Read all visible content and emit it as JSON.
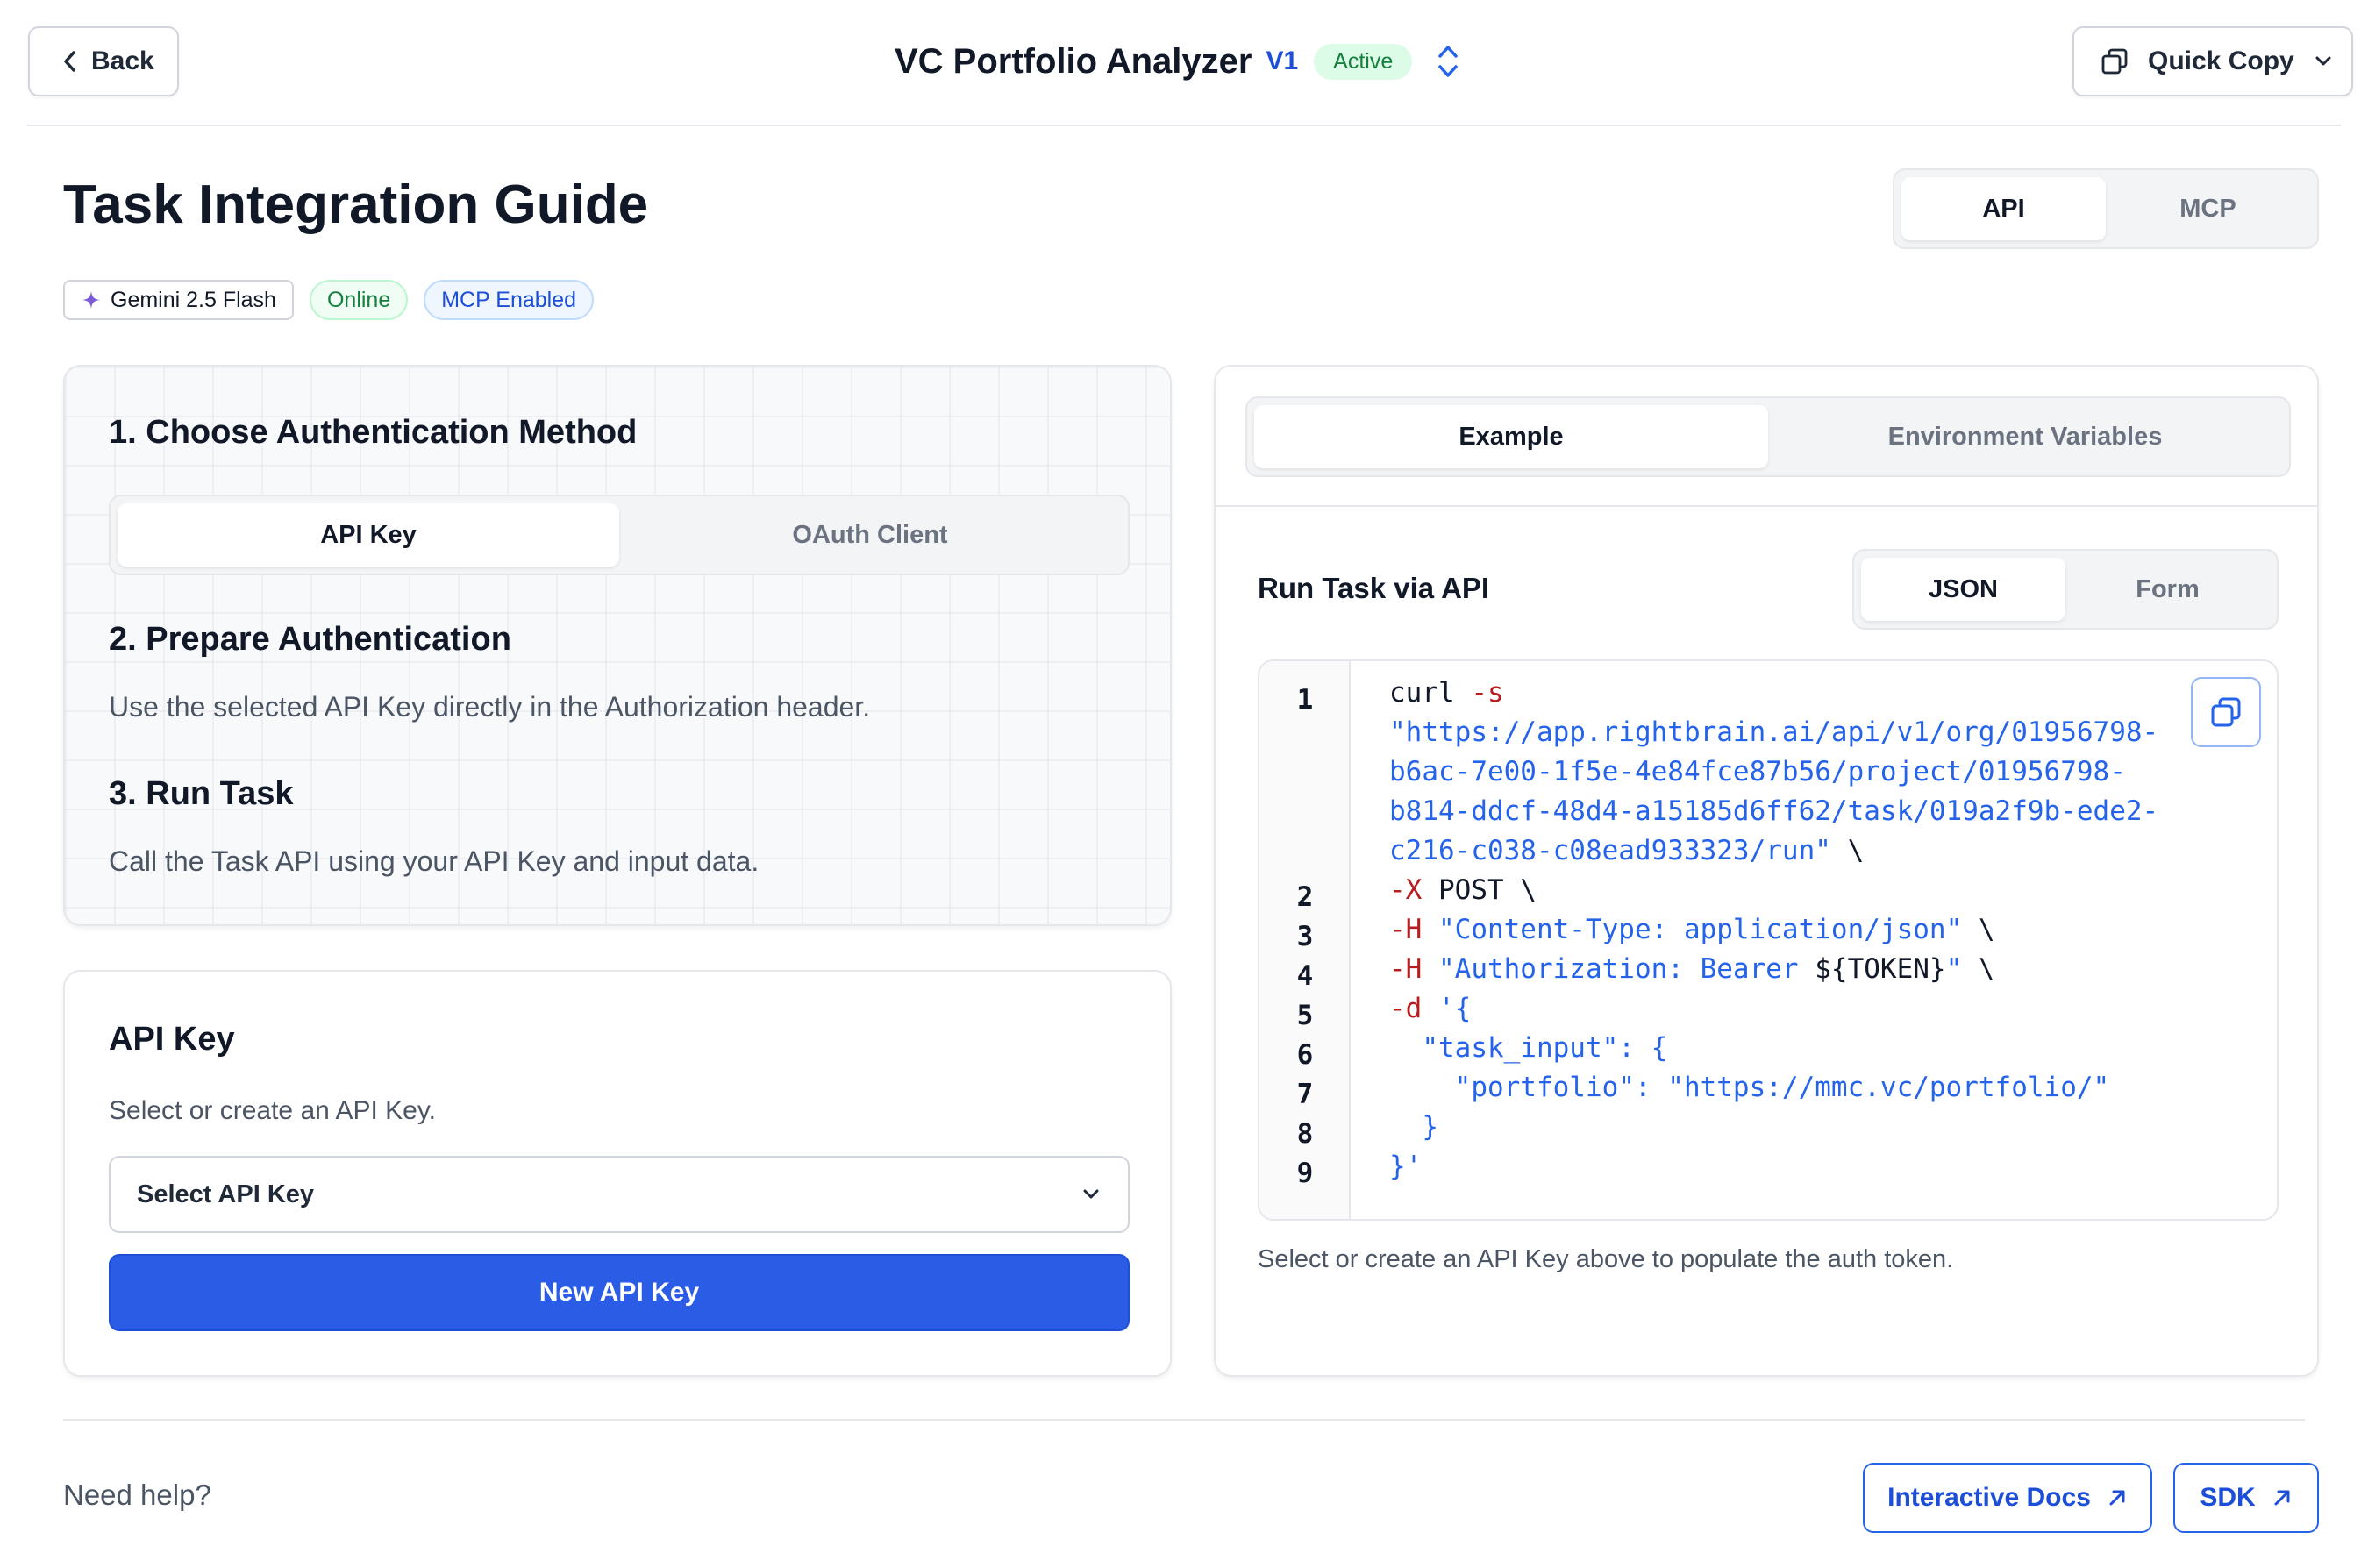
{
  "header": {
    "back_label": "Back",
    "app_title": "VC Portfolio Analyzer",
    "version": "V1",
    "status": "Active",
    "quick_copy_label": "Quick Copy"
  },
  "page": {
    "title": "Task Integration Guide",
    "badges": {
      "model": "Gemini 2.5 Flash",
      "online": "Online",
      "mcp": "MCP Enabled"
    },
    "mode_tabs": [
      {
        "label": "API",
        "active": true
      },
      {
        "label": "MCP",
        "active": false
      }
    ]
  },
  "guide": {
    "step1_title": "1. Choose Authentication Method",
    "auth_tabs": [
      {
        "label": "API Key",
        "active": true
      },
      {
        "label": "OAuth Client",
        "active": false
      }
    ],
    "step2_title": "2. Prepare Authentication",
    "step2_text": "Use the selected API Key directly in the Authorization header.",
    "step3_title": "3. Run Task",
    "step3_text": "Call the Task API using your API Key and input data."
  },
  "api_key": {
    "title": "API Key",
    "description": "Select or create an API Key.",
    "select_placeholder": "Select API Key",
    "new_button": "New API Key"
  },
  "example": {
    "tabs": [
      {
        "label": "Example",
        "active": true
      },
      {
        "label": "Environment Variables",
        "active": false
      }
    ],
    "section_title": "Run Task via API",
    "format_tabs": [
      {
        "label": "JSON",
        "active": true
      },
      {
        "label": "Form",
        "active": false
      }
    ],
    "line_numbers": [
      "1",
      "2",
      "3",
      "4",
      "5",
      "6",
      "7",
      "8",
      "9"
    ],
    "code": {
      "l1a_cmd": "curl ",
      "l1a_flag": "-s",
      "l1b": "\"https://app.rightbrain.ai/api/v1/org/01956798-",
      "l1c": "b6ac-7e00-1f5e-4e84fce87b56/project/01956798-",
      "l1d": "b814-ddcf-48d4-a15185d6ff62/task/019a2f9b-ede2-",
      "l1e_str": "c216-c038-c08ead933323/run\"",
      "l1e_tail": " \\",
      "l2_flag": "-X",
      "l2_rest": " POST \\",
      "l3_flag": "-H",
      "l3_str": " \"Content-Type: application/json\"",
      "l3_tail": " \\",
      "l4_flag": "-H",
      "l4_str": " \"Authorization: Bearer ",
      "l4_var": "${TOKEN}",
      "l4_str2": "\"",
      "l4_tail": " \\",
      "l5_flag": "-d",
      "l5_str": " '{",
      "l6": "  \"task_input\": {",
      "l7": "    \"portfolio\": \"https://mmc.vc/portfolio/\"",
      "l8": "  }",
      "l9": "}'"
    },
    "hint": "Select or create an API Key above to populate the auth token."
  },
  "footer": {
    "help_text": "Need help?",
    "docs_label": "Interactive Docs",
    "sdk_label": "SDK"
  },
  "colors": {
    "primary": "#2b5ce6",
    "link": "#1d4ed8",
    "active_green": "#15803d",
    "code_flag": "#b91c1c",
    "code_string": "#2563eb"
  }
}
